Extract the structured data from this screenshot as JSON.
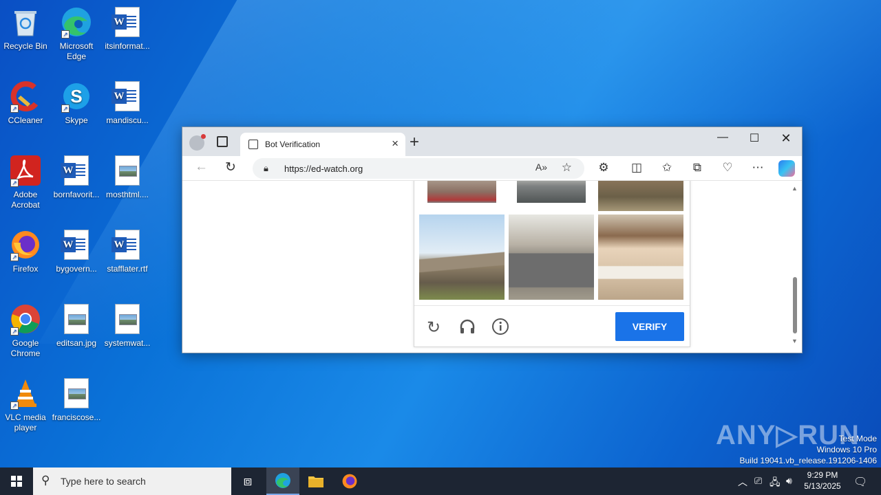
{
  "desktop": {
    "icons": [
      {
        "label": "Recycle Bin",
        "icon": "recycle-bin-icon"
      },
      {
        "label": "Microsoft Edge",
        "icon": "edge-icon"
      },
      {
        "label": "itsinformat...",
        "icon": "word-doc-icon"
      },
      {
        "label": "CCleaner",
        "icon": "ccleaner-icon"
      },
      {
        "label": "Skype",
        "icon": "skype-icon"
      },
      {
        "label": "mandiscu...",
        "icon": "word-doc-icon"
      },
      {
        "label": "Adobe Acrobat",
        "icon": "acrobat-icon"
      },
      {
        "label": "bornfavorit...",
        "icon": "word-doc-icon"
      },
      {
        "label": "mosthtml....",
        "icon": "image-file-icon"
      },
      {
        "label": "Firefox",
        "icon": "firefox-icon"
      },
      {
        "label": "bygovern...",
        "icon": "word-doc-icon"
      },
      {
        "label": "stafflater.rtf",
        "icon": "word-doc-icon"
      },
      {
        "label": "Google Chrome",
        "icon": "chrome-icon"
      },
      {
        "label": "editsan.jpg",
        "icon": "image-file-icon"
      },
      {
        "label": "systemwat...",
        "icon": "image-file-icon"
      },
      {
        "label": "VLC media player",
        "icon": "vlc-icon"
      },
      {
        "label": "franciscose...",
        "icon": "image-file-icon"
      }
    ]
  },
  "browser": {
    "tab_title": "Bot Verification",
    "url": "https://ed-watch.org",
    "captcha": {
      "verify_label": "VERIFY",
      "images": [
        "road",
        "car-on-road",
        "tree",
        "bridge",
        "car-house",
        "balcony"
      ]
    }
  },
  "watermark": {
    "brand": "ANY▷RUN",
    "line1": "Test Mode",
    "line2": "Windows 10 Pro",
    "line3": "Build 19041.vb_release.191206-1406"
  },
  "taskbar": {
    "search_placeholder": "Type here to search",
    "time": "9:29 PM",
    "date": "5/13/2025"
  },
  "colors": {
    "accent": "#1a73e8",
    "taskbar": "#1d2533"
  }
}
